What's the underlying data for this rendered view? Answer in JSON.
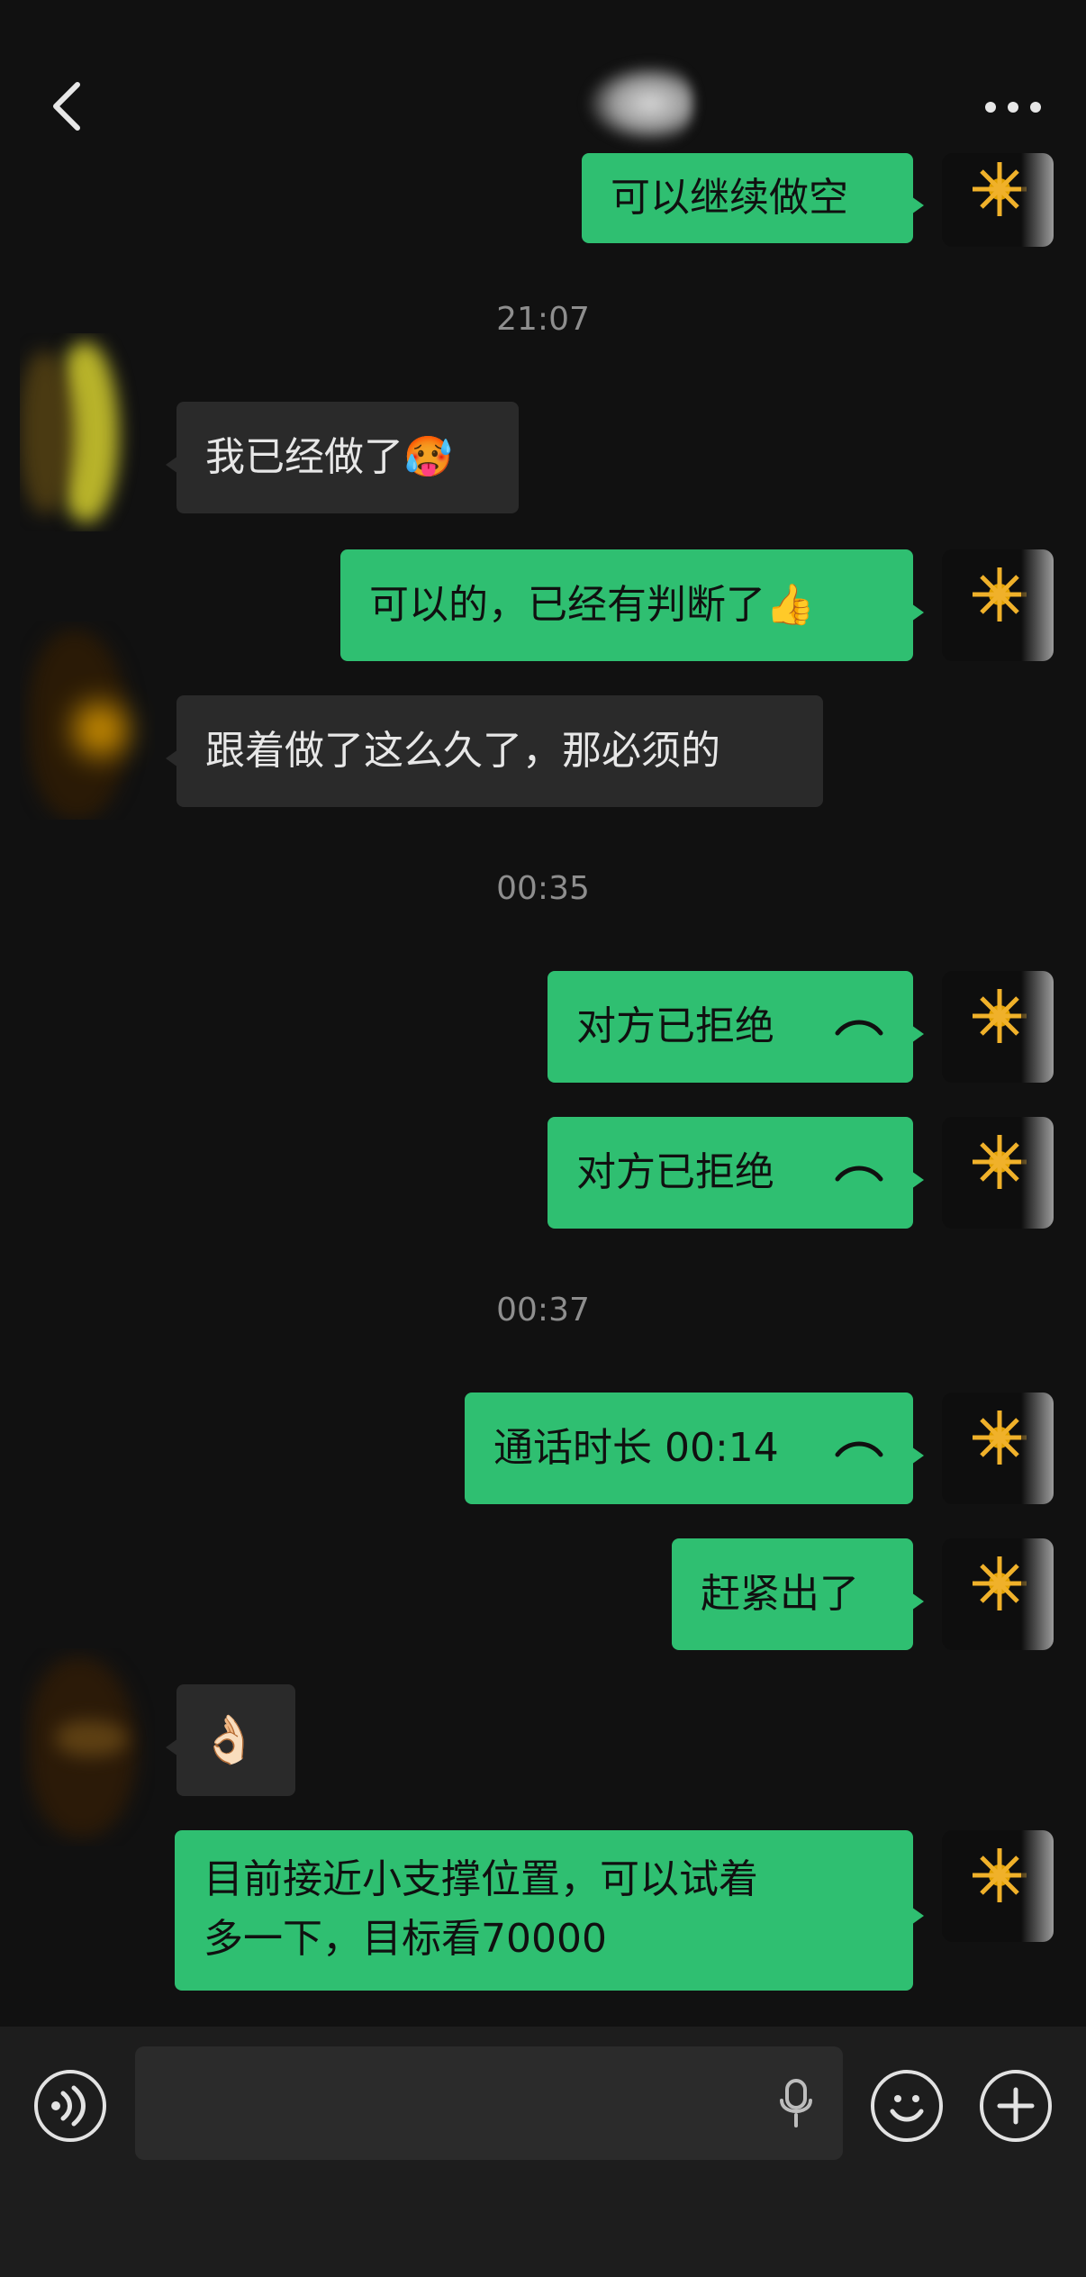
{
  "header": {
    "title": "",
    "back_label": "",
    "more_label": ""
  },
  "chat": {
    "timestamps": [
      {
        "text": "21:07"
      },
      {
        "text": "00:35"
      },
      {
        "text": "00:37"
      }
    ],
    "messages": [
      {
        "side": "sent",
        "text": "可以继续做空"
      },
      {
        "side": "recv",
        "text": "我已经做了",
        "emoji": "🥵"
      },
      {
        "side": "sent",
        "text": "可以的，已经有判断了",
        "emoji": "👍"
      },
      {
        "side": "recv",
        "text": "跟着做了这么久了，那必须的"
      },
      {
        "side": "sent",
        "text": "对方已拒绝",
        "icon": "phone-icon"
      },
      {
        "side": "sent",
        "text": "对方已拒绝",
        "icon": "phone-icon"
      },
      {
        "side": "sent",
        "text": "通话时长 00:14",
        "icon": "phone-icon"
      },
      {
        "side": "sent",
        "text": "赶紧出了"
      },
      {
        "side": "recv",
        "text": "👌🏻"
      },
      {
        "side": "sent",
        "text_lines": [
          "目前接近小支撑位置，可以试着",
          "多一下，目标看70000"
        ]
      }
    ]
  },
  "inputbar": {
    "placeholder": ""
  },
  "colors": {
    "sent_bubble": "#2fbf71",
    "recv_bubble": "#2a2a2a",
    "background": "#111111"
  }
}
